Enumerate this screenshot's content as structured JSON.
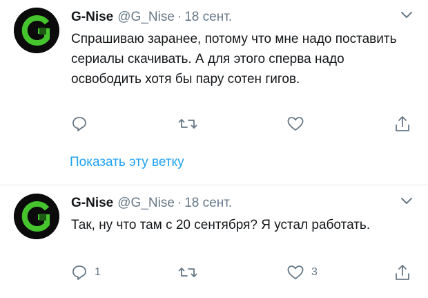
{
  "colors": {
    "accent": "#1da1f2",
    "muted": "#657786",
    "text": "#14171a",
    "avatar_green": "#46c42e"
  },
  "tweets": [
    {
      "name": "G-Nise",
      "handle": "@G_Nise",
      "separator": "·",
      "time": "18 сент.",
      "text": "Спрашиваю заранее, потому что мне надо поставить сериалы скачивать. А для этого сперва надо освободить хотя бы пару сотен гигов.",
      "reply_count": "",
      "like_count": "",
      "show_thread": "Показать эту ветку"
    },
    {
      "name": "G-Nise",
      "handle": "@G_Nise",
      "separator": "·",
      "time": "18 сент.",
      "text": "Так, ну что там с 20 сентября? Я устал работать.",
      "reply_count": "1",
      "like_count": "3"
    }
  ],
  "icons": [
    "reply-icon",
    "retweet-icon",
    "like-icon",
    "share-icon",
    "chevron-down-icon"
  ]
}
